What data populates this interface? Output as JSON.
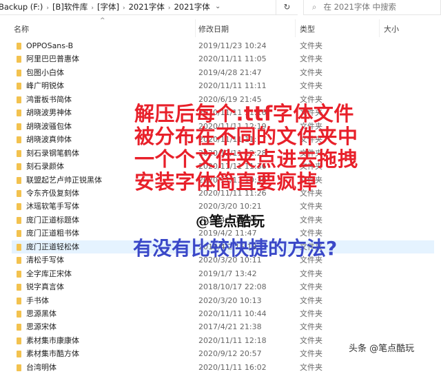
{
  "address": {
    "crumbs": [
      "Backup (F:)",
      "[B]软件库",
      "[字体]",
      "2021字体",
      "2021字体"
    ],
    "refresh_icon": "↻",
    "dropdown_icon": "⌄"
  },
  "search": {
    "placeholder": "在 2021字体 中搜索"
  },
  "columns": {
    "name": "名称",
    "date": "修改日期",
    "type": "类型",
    "size": "大小"
  },
  "rows": [
    {
      "name": "OPPOSans-B",
      "date": "2019/11/23 10:24",
      "type": "文件夹"
    },
    {
      "name": "阿里巴巴普惠体",
      "date": "2020/11/11 11:05",
      "type": "文件夹"
    },
    {
      "name": "包图小白体",
      "date": "2019/4/28 21:47",
      "type": "文件夹"
    },
    {
      "name": "峰广明锐体",
      "date": "2020/11/11 11:11",
      "type": "文件夹"
    },
    {
      "name": "鸿雷板书简体",
      "date": "2020/6/19 21:45",
      "type": "文件夹"
    },
    {
      "name": "胡晓波男神体",
      "date": "2020/11/11 11:16",
      "type": "文件夹"
    },
    {
      "name": "胡晓波骚包体",
      "date": "2020/11/11 12:19",
      "type": "文件夹"
    },
    {
      "name": "胡晓波真帅体",
      "date": "2020/11/11 11:17",
      "type": "文件夹"
    },
    {
      "name": "刻石录钢笔鹤体",
      "date": "2020/11/11 12:28",
      "type": "文件夹"
    },
    {
      "name": "刻石录颜体",
      "date": "2020/11/11 11:36",
      "type": "文件夹"
    },
    {
      "name": "联盟起艺卢帅正锐黑体",
      "date": "2020/11/11 10:30",
      "type": "文件夹"
    },
    {
      "name": "令东齐伋复刻体",
      "date": "2020/11/11 11:26",
      "type": "文件夹"
    },
    {
      "name": "沐瑶软笔手写体",
      "date": "2020/3/20 10:21",
      "type": "文件夹"
    },
    {
      "name": "庞门正道标题体",
      "date": "2019/4/2 13:08",
      "type": "文件夹"
    },
    {
      "name": "庞门正道粗书体",
      "date": "2019/4/2 11:47",
      "type": "文件夹"
    },
    {
      "name": "庞门正道轻松体",
      "date": "2019/4/2 15:18",
      "type": "文件夹",
      "selected": true
    },
    {
      "name": "清松手写体",
      "date": "2020/3/20 10:11",
      "type": "文件夹"
    },
    {
      "name": "全字库正宋体",
      "date": "2019/1/7 13:42",
      "type": "文件夹"
    },
    {
      "name": "锐字真言体",
      "date": "2018/10/17 22:08",
      "type": "文件夹"
    },
    {
      "name": "手书体",
      "date": "2020/3/20 10:13",
      "type": "文件夹"
    },
    {
      "name": "思源黑体",
      "date": "2020/11/11 10:44",
      "type": "文件夹"
    },
    {
      "name": "思源宋体",
      "date": "2017/4/21 21:38",
      "type": "文件夹"
    },
    {
      "name": "素材集市康康体",
      "date": "2020/11/11 12:18",
      "type": "文件夹"
    },
    {
      "name": "素材集市酷方体",
      "date": "2020/9/12 20:57",
      "type": "文件夹"
    },
    {
      "name": "台湾明体",
      "date": "2020/11/11 16:02",
      "type": "文件夹"
    }
  ],
  "overlay": {
    "red_lines": [
      "解压后每个.ttf字体文件",
      "被分布在不同的文件夹中",
      "一个个文件夹点进去拖拽",
      "安装字体简直要疯掉"
    ],
    "signature": "@笔点酷玩",
    "question": "有没有比较快捷的方法?",
    "watermark": "头条 @笔点酷玩"
  }
}
